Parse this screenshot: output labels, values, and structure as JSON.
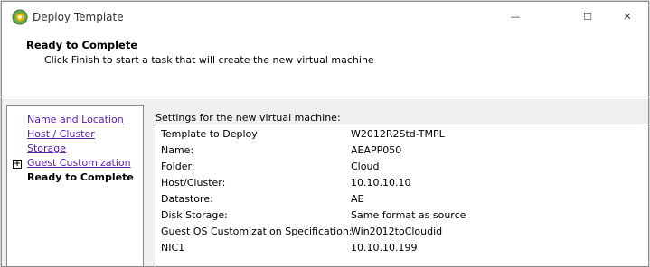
{
  "window": {
    "title": "Deploy Template",
    "controls": {
      "minimize": "—",
      "maximize": "☐",
      "close": "✕"
    }
  },
  "header": {
    "title": "Ready to Complete",
    "subtitle": "Click Finish to start a task that will create the new virtual machine"
  },
  "nav": {
    "items": [
      {
        "label": "Name and Location"
      },
      {
        "label": "Host / Cluster"
      },
      {
        "label": "Storage"
      },
      {
        "label": "Guest Customization",
        "expander": "+"
      },
      {
        "label": "Ready to Complete",
        "current": true
      }
    ]
  },
  "settings": {
    "label": "Settings for the new virtual machine:",
    "rows": [
      {
        "key": "Template to Deploy",
        "value": "W2012R2Std-TMPL"
      },
      {
        "key": "Name:",
        "value": "AEAPP050"
      },
      {
        "key": "Folder:",
        "value": "Cloud"
      },
      {
        "key": "Host/Cluster:",
        "value": "10.10.10.10"
      },
      {
        "key": "Datastore:",
        "value": "AE"
      },
      {
        "key": "Disk Storage:",
        "value": "Same format as source"
      },
      {
        "key": "Guest OS Customization Specification:",
        "value": "Win2012toCloudid"
      },
      {
        "key": "NIC1",
        "value": "10.10.10.199"
      }
    ]
  },
  "colors": {
    "link": "#5a1aa8",
    "background": "#f0f0f0",
    "border": "#828790"
  },
  "icons": {
    "app": "vsphere-logo-icon"
  }
}
